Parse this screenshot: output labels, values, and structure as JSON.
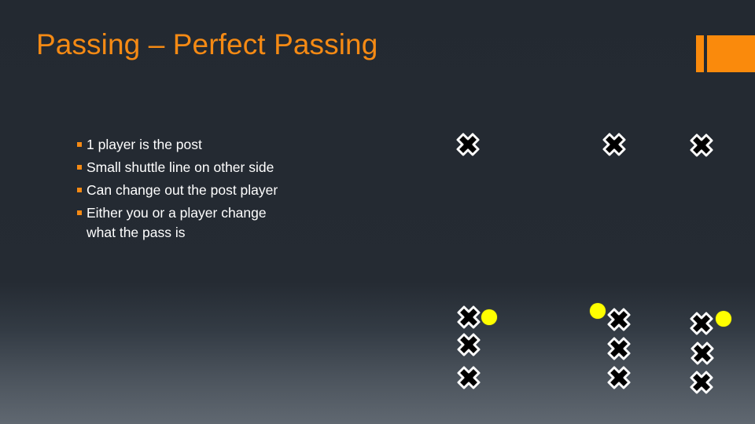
{
  "slide": {
    "title": "Passing – Perfect Passing",
    "accent_color": "#f58a14",
    "bullets": [
      "1 player is the post",
      "Small shuttle line on other side",
      "Can change out the post player",
      "Either you or a player change what the pass is"
    ]
  },
  "diagram": {
    "player_icon": "cross-marker-icon",
    "ball_icon": "yellow-ball-icon",
    "player_color": "#000000",
    "player_outline_color": "#ffffff",
    "ball_color": "#ffff00",
    "groups": [
      {
        "name": "top-left-post",
        "players": 1,
        "balls": 0
      },
      {
        "name": "top-middle-post",
        "players": 1,
        "balls": 0
      },
      {
        "name": "top-right-post",
        "players": 1,
        "balls": 0
      },
      {
        "name": "bottom-left-line",
        "players": 3,
        "balls": 1
      },
      {
        "name": "bottom-middle-line",
        "players": 3,
        "balls": 1
      },
      {
        "name": "bottom-right-line",
        "players": 3,
        "balls": 1
      }
    ]
  }
}
